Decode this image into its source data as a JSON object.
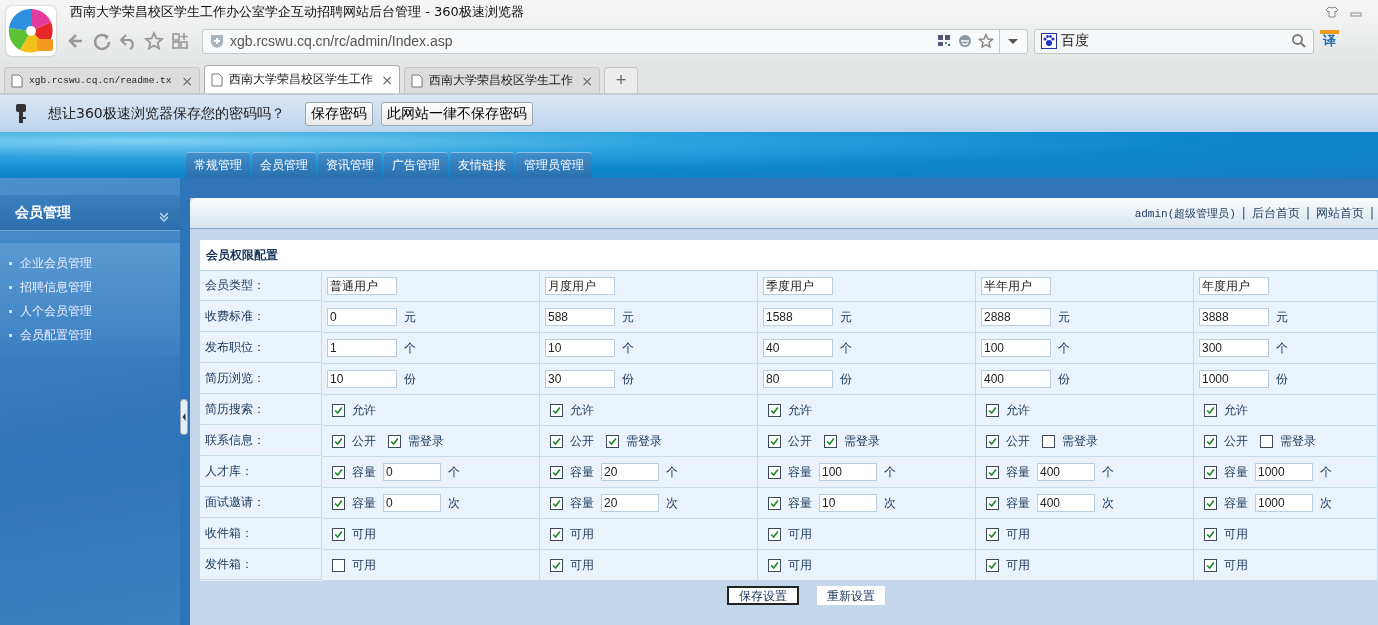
{
  "window": {
    "title": "西南大学荣昌校区学生工作办公室学企互动招聘网站后台管理 - 360极速浏览器"
  },
  "address_bar": {
    "url": "xgb.rcswu.cq.cn/rc/admin/Index.asp"
  },
  "search": {
    "engine": "百度"
  },
  "translate_button": "译",
  "tabs": [
    {
      "title": "xgb.rcswu.cq.cn/readme.tx",
      "selected": false,
      "close": "×"
    },
    {
      "title": "西南大学荣昌校区学生工作",
      "selected": true,
      "close": "×"
    },
    {
      "title": "西南大学荣昌校区学生工作",
      "selected": false,
      "close": "×"
    }
  ],
  "new_tab": "+",
  "password_bar": {
    "message": "想让360极速浏览器保存您的密码吗？",
    "buttons": [
      "保存密码",
      "此网站一律不保存密码"
    ]
  },
  "nav_tabs": [
    "常规管理",
    "会员管理",
    "资讯管理",
    "广告管理",
    "友情链接",
    "管理员管理"
  ],
  "sidebar": {
    "title": "会员管理",
    "items": [
      "企业会员管理",
      "招聘信息管理",
      "人个会员管理",
      "会员配置管理"
    ]
  },
  "top_links": [
    {
      "kind": "user",
      "text": "admin(超级管理员)"
    },
    {
      "kind": "separator",
      "text": "|"
    },
    {
      "kind": "link",
      "text": "后台首页"
    },
    {
      "kind": "separator",
      "text": "|"
    },
    {
      "kind": "link",
      "text": "网站首页"
    },
    {
      "kind": "separator",
      "text": "|"
    }
  ],
  "table": {
    "title": "会员权限配置",
    "rows": [
      {
        "label": "会员类型：",
        "cells": [
          [
            {
              "kind": "input",
              "value": "普通用户"
            }
          ],
          [
            {
              "kind": "input",
              "value": "月度用户"
            }
          ],
          [
            {
              "kind": "input",
              "value": "季度用户"
            }
          ],
          [
            {
              "kind": "input",
              "value": "半年用户"
            }
          ],
          [
            {
              "kind": "input",
              "value": "年度用户"
            }
          ]
        ]
      },
      {
        "label": "收费标准：",
        "cells": [
          [
            {
              "kind": "input",
              "value": "0"
            },
            {
              "kind": "unit",
              "text": "元"
            }
          ],
          [
            {
              "kind": "input",
              "value": "588"
            },
            {
              "kind": "unit",
              "text": "元"
            }
          ],
          [
            {
              "kind": "input",
              "value": "1588"
            },
            {
              "kind": "unit",
              "text": "元"
            }
          ],
          [
            {
              "kind": "input",
              "value": "2888"
            },
            {
              "kind": "unit",
              "text": "元"
            }
          ],
          [
            {
              "kind": "input",
              "value": "3888"
            },
            {
              "kind": "unit",
              "text": "元"
            }
          ]
        ]
      },
      {
        "label": "发布职位：",
        "cells": [
          [
            {
              "kind": "input",
              "value": "1"
            },
            {
              "kind": "unit",
              "text": "个"
            }
          ],
          [
            {
              "kind": "input",
              "value": "10"
            },
            {
              "kind": "unit",
              "text": "个"
            }
          ],
          [
            {
              "kind": "input",
              "value": "40"
            },
            {
              "kind": "unit",
              "text": "个"
            }
          ],
          [
            {
              "kind": "input",
              "value": "100"
            },
            {
              "kind": "unit",
              "text": "个"
            }
          ],
          [
            {
              "kind": "input",
              "value": "300"
            },
            {
              "kind": "unit",
              "text": "个"
            }
          ]
        ]
      },
      {
        "label": "简历浏览：",
        "cells": [
          [
            {
              "kind": "input",
              "value": "10"
            },
            {
              "kind": "unit",
              "text": "份"
            }
          ],
          [
            {
              "kind": "input",
              "value": "30"
            },
            {
              "kind": "unit",
              "text": "份"
            }
          ],
          [
            {
              "kind": "input",
              "value": "80"
            },
            {
              "kind": "unit",
              "text": "份"
            }
          ],
          [
            {
              "kind": "input",
              "value": "400"
            },
            {
              "kind": "unit",
              "text": "份"
            }
          ],
          [
            {
              "kind": "input",
              "value": "1000"
            },
            {
              "kind": "unit",
              "text": "份"
            }
          ]
        ]
      },
      {
        "label": "简历搜索：",
        "cells": [
          [
            {
              "kind": "check",
              "label": "允许",
              "checked": true
            }
          ],
          [
            {
              "kind": "check",
              "label": "允许",
              "checked": true
            }
          ],
          [
            {
              "kind": "check",
              "label": "允许",
              "checked": true
            }
          ],
          [
            {
              "kind": "check",
              "label": "允许",
              "checked": true
            }
          ],
          [
            {
              "kind": "check",
              "label": "允许",
              "checked": true
            }
          ]
        ]
      },
      {
        "label": "联系信息：",
        "cells": [
          [
            {
              "kind": "check",
              "label": "公开",
              "checked": true
            },
            {
              "kind": "check",
              "label": "需登录",
              "checked": true
            }
          ],
          [
            {
              "kind": "check",
              "label": "公开",
              "checked": true
            },
            {
              "kind": "check",
              "label": "需登录",
              "checked": true
            }
          ],
          [
            {
              "kind": "check",
              "label": "公开",
              "checked": true
            },
            {
              "kind": "check",
              "label": "需登录",
              "checked": true
            }
          ],
          [
            {
              "kind": "check",
              "label": "公开",
              "checked": true
            },
            {
              "kind": "check",
              "label": "需登录",
              "checked": false
            }
          ],
          [
            {
              "kind": "check",
              "label": "公开",
              "checked": true
            },
            {
              "kind": "check",
              "label": "需登录",
              "checked": false
            }
          ]
        ]
      },
      {
        "label": "人才库：",
        "cells": [
          [
            {
              "kind": "check",
              "label": "容量",
              "checked": true
            },
            {
              "kind": "small_input",
              "value": "0"
            },
            {
              "kind": "unit",
              "text": "个"
            }
          ],
          [
            {
              "kind": "check",
              "label": "容量",
              "checked": true
            },
            {
              "kind": "small_input",
              "value": "20"
            },
            {
              "kind": "unit",
              "text": "个"
            }
          ],
          [
            {
              "kind": "check",
              "label": "容量",
              "checked": true
            },
            {
              "kind": "small_input",
              "value": "100"
            },
            {
              "kind": "unit",
              "text": "个"
            }
          ],
          [
            {
              "kind": "check",
              "label": "容量",
              "checked": true
            },
            {
              "kind": "small_input",
              "value": "400"
            },
            {
              "kind": "unit",
              "text": "个"
            }
          ],
          [
            {
              "kind": "check",
              "label": "容量",
              "checked": true
            },
            {
              "kind": "small_input",
              "value": "1000"
            },
            {
              "kind": "unit",
              "text": "个"
            }
          ]
        ]
      },
      {
        "label": "面试邀请：",
        "cells": [
          [
            {
              "kind": "check",
              "label": "容量",
              "checked": true
            },
            {
              "kind": "small_input",
              "value": "0"
            },
            {
              "kind": "unit",
              "text": "次"
            }
          ],
          [
            {
              "kind": "check",
              "label": "容量",
              "checked": true
            },
            {
              "kind": "small_input",
              "value": "20"
            },
            {
              "kind": "unit",
              "text": "次"
            }
          ],
          [
            {
              "kind": "check",
              "label": "容量",
              "checked": true
            },
            {
              "kind": "small_input",
              "value": "10"
            },
            {
              "kind": "unit",
              "text": "次"
            }
          ],
          [
            {
              "kind": "check",
              "label": "容量",
              "checked": true
            },
            {
              "kind": "small_input",
              "value": "400"
            },
            {
              "kind": "unit",
              "text": "次"
            }
          ],
          [
            {
              "kind": "check",
              "label": "容量",
              "checked": true
            },
            {
              "kind": "small_input",
              "value": "1000"
            },
            {
              "kind": "unit",
              "text": "次"
            }
          ]
        ]
      },
      {
        "label": "收件箱：",
        "cells": [
          [
            {
              "kind": "check",
              "label": "可用",
              "checked": true
            }
          ],
          [
            {
              "kind": "check",
              "label": "可用",
              "checked": true
            }
          ],
          [
            {
              "kind": "check",
              "label": "可用",
              "checked": true
            }
          ],
          [
            {
              "kind": "check",
              "label": "可用",
              "checked": true
            }
          ],
          [
            {
              "kind": "check",
              "label": "可用",
              "checked": true
            }
          ]
        ]
      },
      {
        "label": "发件箱：",
        "cells": [
          [
            {
              "kind": "check",
              "label": "可用",
              "checked": false
            }
          ],
          [
            {
              "kind": "check",
              "label": "可用",
              "checked": true
            }
          ],
          [
            {
              "kind": "check",
              "label": "可用",
              "checked": true
            }
          ],
          [
            {
              "kind": "check",
              "label": "可用",
              "checked": true
            }
          ],
          [
            {
              "kind": "check",
              "label": "可用",
              "checked": true
            }
          ]
        ]
      }
    ]
  },
  "form_buttons": [
    "保存设置",
    "重新设置"
  ]
}
